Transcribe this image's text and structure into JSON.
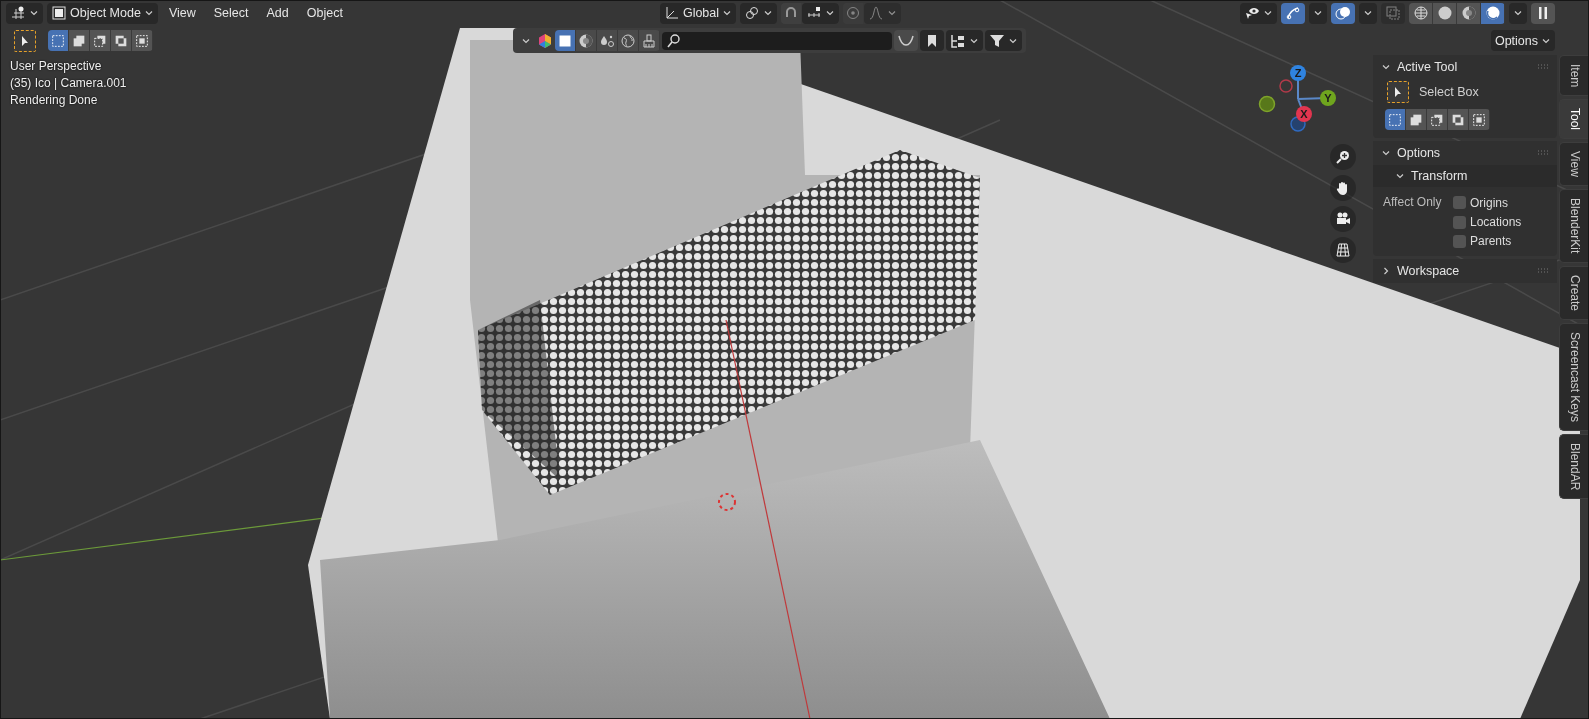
{
  "header": {
    "mode": "Object Mode",
    "menus": [
      "View",
      "Select",
      "Add",
      "Object"
    ],
    "orientation": "Global",
    "snap": {
      "on": false
    },
    "proportional": {
      "on": false
    },
    "gizmos": {
      "on": true
    },
    "overlays": {
      "on": true
    },
    "xray": {
      "on": false
    },
    "shading": [
      {
        "kind": "wireframe",
        "selected": false
      },
      {
        "kind": "solid",
        "selected": false
      },
      {
        "kind": "material",
        "selected": false
      },
      {
        "kind": "rendered",
        "selected": true
      }
    ]
  },
  "tool_header": {
    "select_modes": [
      {
        "kind": "set",
        "selected": true
      },
      {
        "kind": "extend",
        "selected": false
      },
      {
        "kind": "subtract",
        "selected": false
      },
      {
        "kind": "invert",
        "selected": false
      },
      {
        "kind": "intersect",
        "selected": false
      }
    ],
    "options": "Options"
  },
  "filter_bar": {
    "views": [
      {
        "kind": "solid",
        "selected": true
      },
      {
        "kind": "material",
        "selected": false
      },
      {
        "kind": "particles",
        "selected": false
      },
      {
        "kind": "world",
        "selected": false
      },
      {
        "kind": "brush",
        "selected": false
      }
    ]
  },
  "viewport": {
    "info": [
      "User Perspective",
      "(35) Ico | Camera.001",
      "Rendering Done"
    ],
    "axes": [
      "Z",
      "Y",
      "X"
    ]
  },
  "sidebar": {
    "panels": [
      {
        "kind": "tool",
        "title": "Active Tool",
        "expanded": true,
        "tool": "Select Box",
        "modes": [
          {
            "kind": "set",
            "selected": true
          },
          {
            "kind": "extend",
            "selected": false
          },
          {
            "kind": "subtract",
            "selected": false
          },
          {
            "kind": "invert",
            "selected": false
          },
          {
            "kind": "intersect",
            "selected": false
          }
        ]
      },
      {
        "kind": "options",
        "title": "Options",
        "expanded": true,
        "subpanel": {
          "title": "Transform",
          "expanded": true
        },
        "affect_label": "Affect Only",
        "checkboxes": [
          {
            "label": "Origins",
            "checked": false
          },
          {
            "label": "Locations",
            "checked": false
          },
          {
            "label": "Parents",
            "checked": false
          }
        ]
      },
      {
        "title": "Workspace",
        "expanded": false
      }
    ]
  },
  "tabs": [
    {
      "label": "Item",
      "selected": false
    },
    {
      "label": "Tool",
      "selected": true
    },
    {
      "label": "View",
      "selected": false
    },
    {
      "label": "BlenderKit",
      "selected": false
    },
    {
      "label": "Create",
      "selected": false
    },
    {
      "label": "Screencast Keys",
      "selected": false
    },
    {
      "label": "BlendAR",
      "selected": false
    }
  ]
}
